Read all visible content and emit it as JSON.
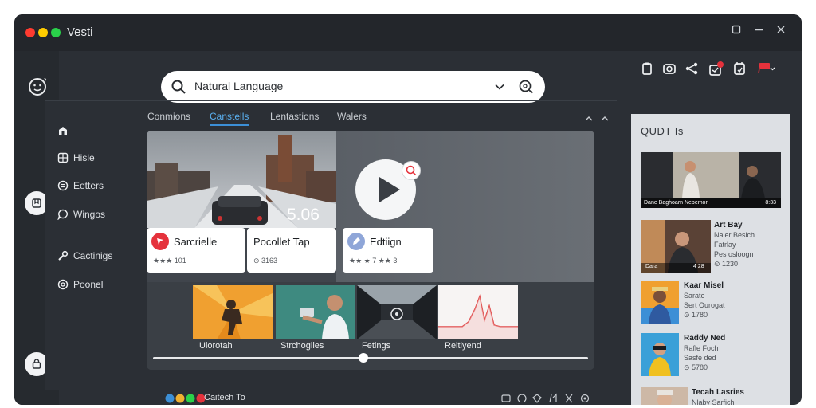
{
  "window": {
    "title": "Vesti",
    "traffic_lights": [
      "#ff3b30",
      "#ffcc00",
      "#2ad14a"
    ],
    "controls": [
      "maximize-icon",
      "minimize-icon",
      "close-icon"
    ]
  },
  "search": {
    "value": "Natural Language"
  },
  "sidebar": {
    "items": [
      {
        "label": "",
        "icon": "home-icon"
      },
      {
        "label": "Hisle",
        "icon": "grid-icon"
      },
      {
        "label": "Eetters",
        "icon": "filter-icon"
      },
      {
        "label": "Wingos",
        "icon": "chat-icon"
      },
      {
        "label": "Cactinigs",
        "icon": "tool-icon"
      },
      {
        "label": "Poonel",
        "icon": "settings-icon"
      }
    ]
  },
  "tabs": [
    {
      "label": "Conmions",
      "active": false
    },
    {
      "label": "Canstells",
      "active": true
    },
    {
      "label": "Lentastions",
      "active": false
    },
    {
      "label": "Walers",
      "active": false
    }
  ],
  "hero": {
    "score": "5.06"
  },
  "cards": [
    {
      "title": "Sarcrielle",
      "sub": "★★★ 101",
      "icon_color": "#e5323c"
    },
    {
      "title": "Pocollet Tap",
      "sub": "⊙ 3163",
      "icon_color": ""
    },
    {
      "title": "Edtiign",
      "sub": "★★ ★ 7  ★★ 3",
      "icon_color": "#8fa6d8"
    }
  ],
  "thumbnails": [
    {
      "label": "Uiorotah"
    },
    {
      "label": "Strchogiies"
    },
    {
      "label": "Fetings"
    },
    {
      "label": "Reltiyend"
    }
  ],
  "status": {
    "text": "Caitech To"
  },
  "panel": {
    "title": "QUDT Is",
    "video_caption": "Dane Baghoarn Nepemon",
    "video_time": "8:33",
    "items": [
      {
        "title": "Art Bay",
        "lines": [
          "Naler Besich",
          "Fatrlay",
          "Pes osloogn",
          "⊙ 1230"
        ],
        "tags": [
          "Dara",
          "4 28"
        ]
      },
      {
        "title": "Kaar Misel",
        "lines": [
          "Sarate",
          "Sert Ourogat",
          "⊙ 1780"
        ],
        "tags": []
      },
      {
        "title": "Raddy Ned",
        "lines": [
          "Rafle Foch",
          "Sasfe ded",
          "⊙ 5780"
        ],
        "tags": []
      },
      {
        "title": "Tecah Lasries",
        "lines": [
          "Nlaby Sarfich"
        ],
        "tags": []
      }
    ]
  }
}
